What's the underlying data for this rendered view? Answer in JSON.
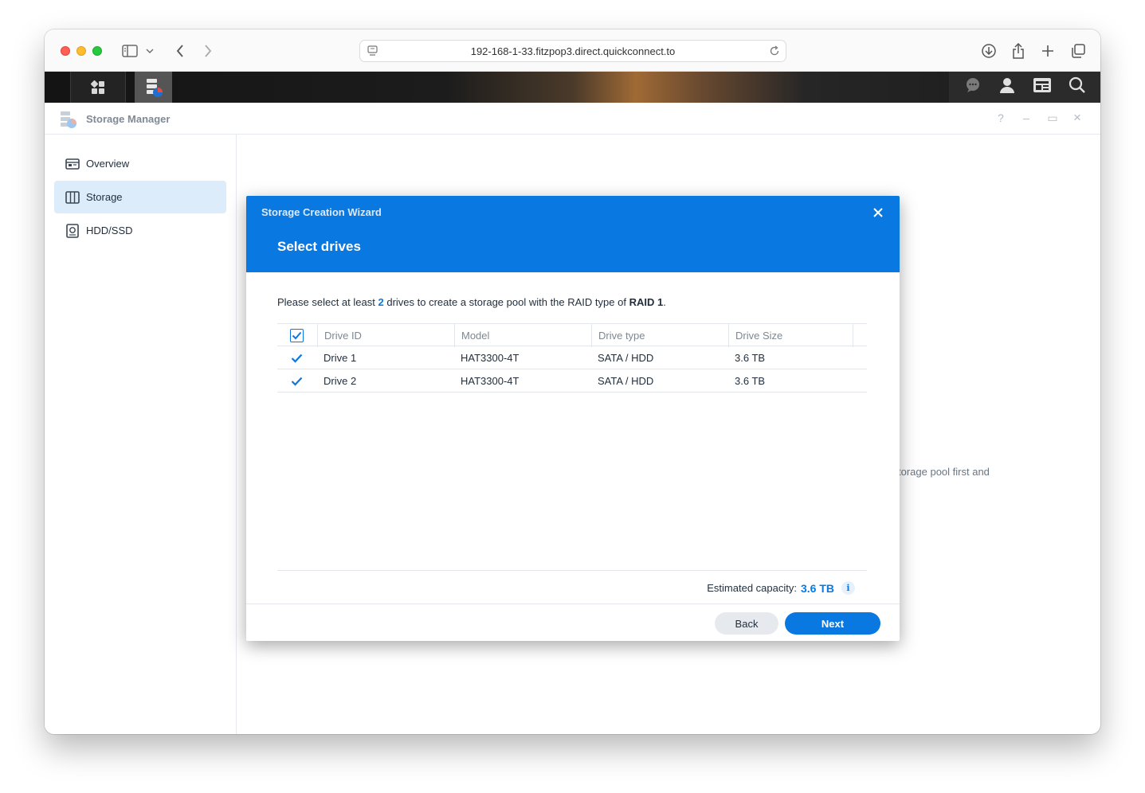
{
  "browser": {
    "url": "192-168-1-33.fitzpop3.direct.quickconnect.to"
  },
  "app": {
    "title": "Storage Manager",
    "window_controls": [
      "?",
      "–",
      "▭",
      "×"
    ]
  },
  "sidebar": {
    "items": [
      {
        "label": "Overview",
        "icon": "overview-icon",
        "active": false
      },
      {
        "label": "Storage",
        "icon": "storage-icon",
        "active": true
      },
      {
        "label": "HDD/SSD",
        "icon": "hdd-icon",
        "active": false
      }
    ]
  },
  "background": {
    "hint_text": "torage pool first and"
  },
  "wizard": {
    "header": "Storage Creation Wizard",
    "step_title": "Select drives",
    "instruction": {
      "prefix": "Please select at least",
      "min_drives": "2",
      "middle": "drives to create a storage pool with the RAID type of",
      "raid_type": "RAID 1",
      "suffix": "."
    },
    "table": {
      "columns": [
        "Drive ID",
        "Model",
        "Drive type",
        "Drive Size"
      ],
      "rows": [
        {
          "id": "Drive 1",
          "model": "HAT3300-4T",
          "type": "SATA / HDD",
          "size": "3.6 TB",
          "checked": true
        },
        {
          "id": "Drive 2",
          "model": "HAT3300-4T",
          "type": "SATA / HDD",
          "size": "3.6 TB",
          "checked": true
        }
      ]
    },
    "capacity_label": "Estimated capacity:",
    "capacity_value": "3.6 TB",
    "back_label": "Back",
    "next_label": "Next"
  },
  "colors": {
    "accent": "#0979e1",
    "selected_nav": "#dcecfb"
  }
}
